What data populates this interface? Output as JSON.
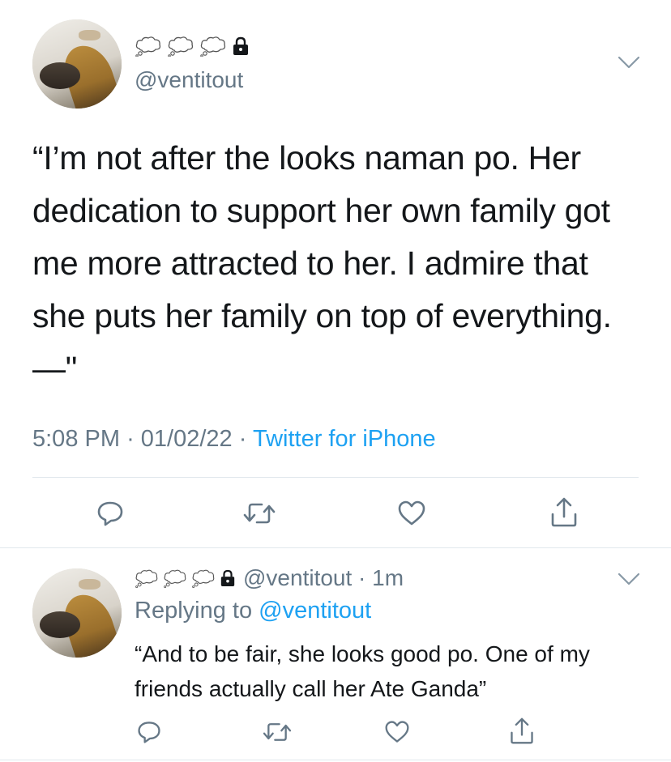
{
  "main_tweet": {
    "display_name_emoji": [
      "thought-balloon",
      "thought-balloon",
      "thought-balloon"
    ],
    "protected": true,
    "handle": "@ventitout",
    "text": "“I’m not after the looks naman po. Her dedication to support her own family got me more attracted to her. I admire that she puts her family on top of everything. —\"",
    "time": "5:08 PM",
    "date": "01/02/22",
    "separator": "·",
    "source": "Twitter for iPhone"
  },
  "reply_tweet": {
    "display_name_emoji": [
      "thought-balloon",
      "thought-balloon",
      "thought-balloon"
    ],
    "protected": true,
    "handle_time": "@ventitout · 1m",
    "replying_prefix": "Replying to ",
    "replying_to": "@ventitout",
    "text": "“And to be fair, she looks good po. One of my friends actually call her Ate Ganda”"
  },
  "icons": {
    "reply": "comment-bubble-icon",
    "retweet": "retweet-icon",
    "like": "heart-icon",
    "share": "share-icon",
    "menu": "chevron-down-icon",
    "lock": "lock-icon"
  },
  "colors": {
    "text": "#14171a",
    "secondary": "#657786",
    "link": "#1da1f2",
    "divider": "#e1e8ed"
  }
}
